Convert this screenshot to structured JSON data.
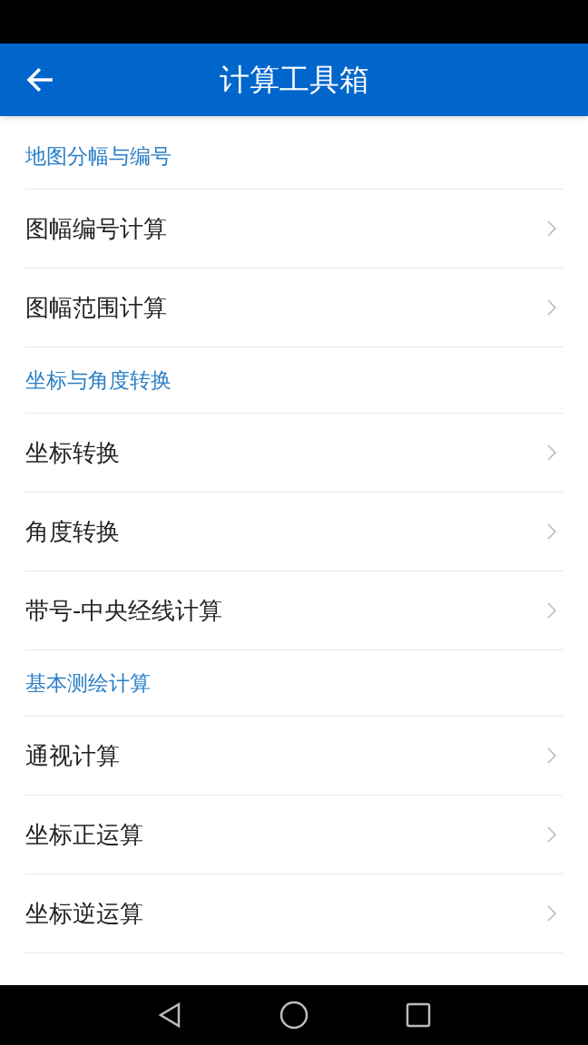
{
  "app_bar": {
    "title": "计算工具箱"
  },
  "sections": [
    {
      "title": "地图分幅与编号",
      "items": [
        "图幅编号计算",
        "图幅范围计算"
      ]
    },
    {
      "title": "坐标与角度转换",
      "items": [
        "坐标转换",
        "角度转换",
        "带号-中央经线计算"
      ]
    },
    {
      "title": "基本测绘计算",
      "items": [
        "通视计算",
        "坐标正运算",
        "坐标逆运算"
      ]
    }
  ]
}
